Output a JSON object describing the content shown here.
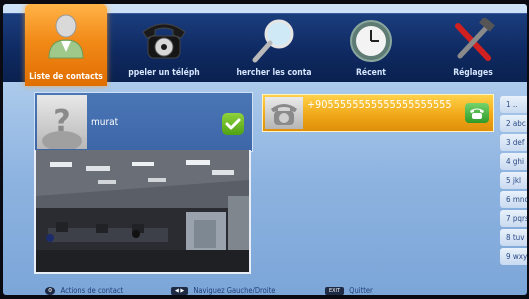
{
  "menu": {
    "contacts": "Liste de contacts",
    "call": "ppeler un téléph",
    "search": "hercher les conta",
    "recent": "Récent",
    "settings": "Réglages"
  },
  "contact": {
    "name": "murat"
  },
  "entry": {
    "number": "+9055555555555555555555"
  },
  "keypad": [
    "1 ..",
    "2 abc",
    "3 def",
    "4 ghi",
    "5 jkl",
    "6 mno",
    "7 pqrs",
    "8 tuv",
    "9 wxyz"
  ],
  "footer": {
    "contact_actions": "Actions de contact",
    "navigate": "Naviguez Gauche/Droite",
    "exit_badge": "EXIT",
    "quit": "Quitter"
  },
  "colors": {
    "accent": "#f28a18",
    "menu_bar": "#0f2a62",
    "selection": "#f0a818"
  }
}
